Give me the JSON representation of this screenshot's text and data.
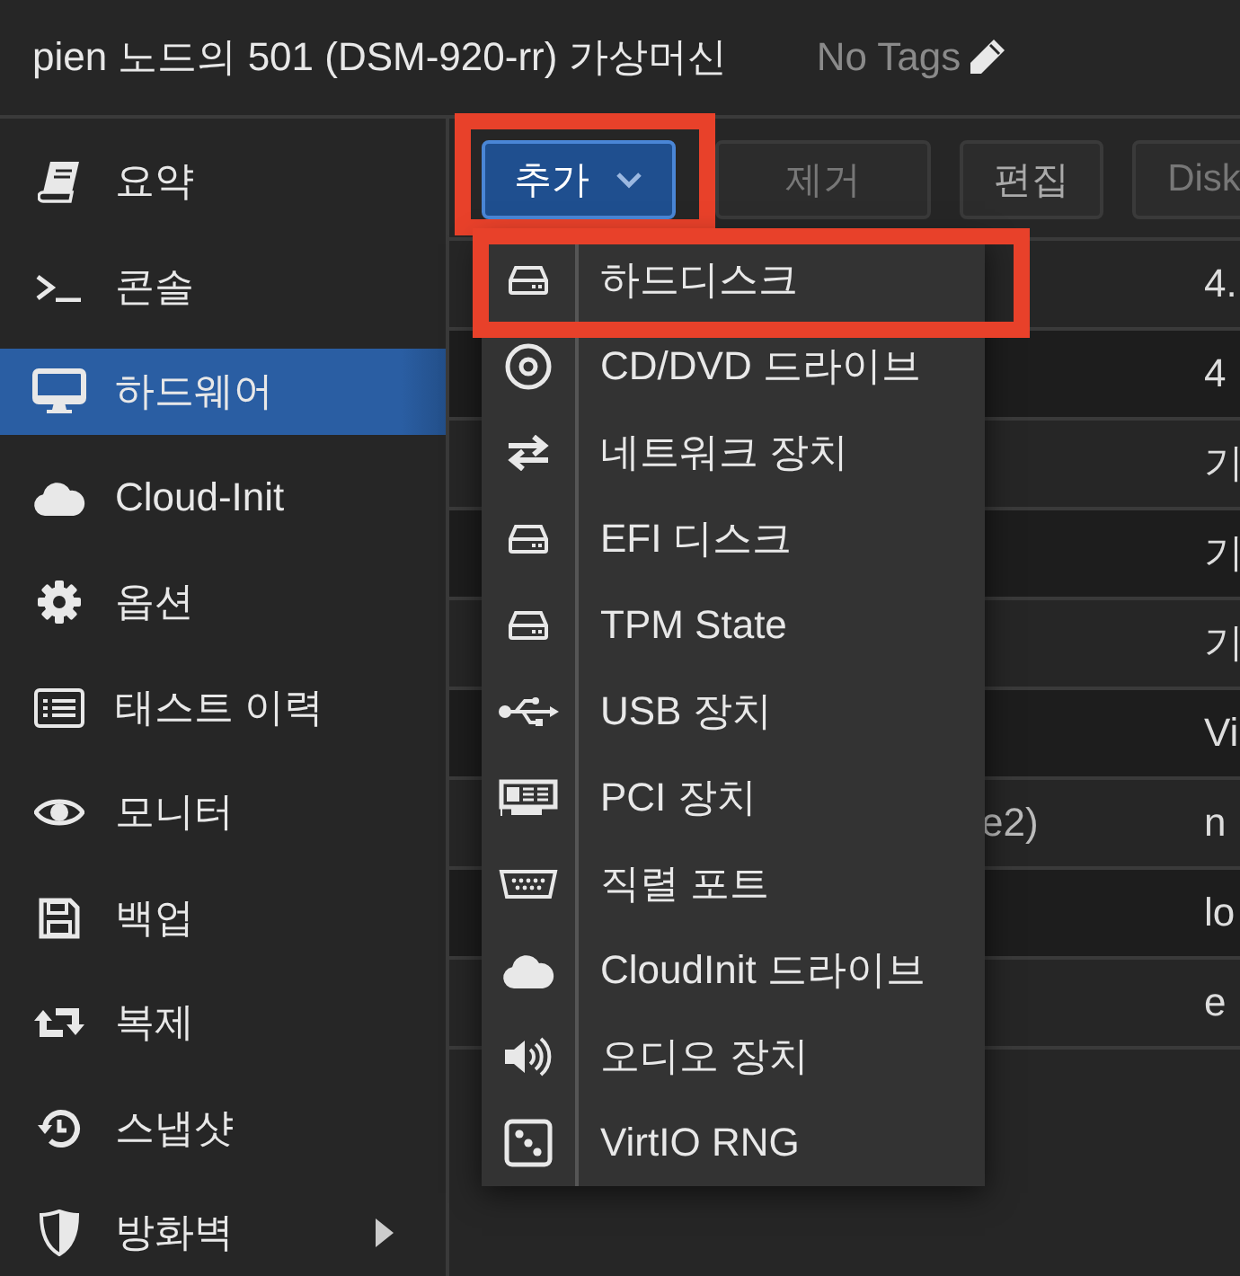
{
  "header": {
    "title": "pien 노드의 501 (DSM-920-rr) 가상머신",
    "tags": "No Tags"
  },
  "sidebar": {
    "items": [
      {
        "label": "요약",
        "selected": false,
        "kind": "item"
      },
      {
        "label": "콘솔",
        "selected": false,
        "kind": "item"
      },
      {
        "label": "하드웨어",
        "selected": true,
        "kind": "item"
      },
      {
        "label": "Cloud-Init",
        "selected": false,
        "kind": "item"
      },
      {
        "label": "옵션",
        "selected": false,
        "kind": "item"
      },
      {
        "label": "태스트 이력",
        "selected": false,
        "kind": "item"
      },
      {
        "label": "모니터",
        "selected": false,
        "kind": "item"
      },
      {
        "label": "백업",
        "selected": false,
        "kind": "item"
      },
      {
        "label": "복제",
        "selected": false,
        "kind": "item"
      },
      {
        "label": "스냅샷",
        "selected": false,
        "kind": "item"
      },
      {
        "label": "방화벽",
        "selected": false,
        "kind": "group"
      }
    ]
  },
  "toolbar": {
    "buttons": [
      {
        "label": "추가",
        "expanded": true,
        "disabled": false
      },
      {
        "label": "제거",
        "expanded": false,
        "disabled": true
      },
      {
        "label": "편집",
        "expanded": false,
        "disabled": false
      },
      {
        "label": "Disk",
        "expanded": false,
        "disabled": true
      }
    ]
  },
  "table": {
    "rows": [
      {
        "column_2": "4."
      },
      {
        "column_2": "4"
      },
      {
        "column_2": "기"
      },
      {
        "column_2": "기"
      },
      {
        "column_2": "기"
      },
      {
        "column_2": "Vi"
      },
      {
        "column_1": "e2)",
        "column_2": "n"
      },
      {
        "column_2": "lo"
      },
      {
        "column_2": "e"
      }
    ]
  },
  "add_menu": {
    "items": [
      "하드디스크",
      "CD/DVD 드라이브",
      "네트워크 장치",
      "EFI 디스크",
      "TPM State",
      "USB 장치",
      "PCI 장치",
      "직렬 포트",
      "CloudInit 드라이브",
      "오디오 장치",
      "VirtIO RNG"
    ]
  }
}
